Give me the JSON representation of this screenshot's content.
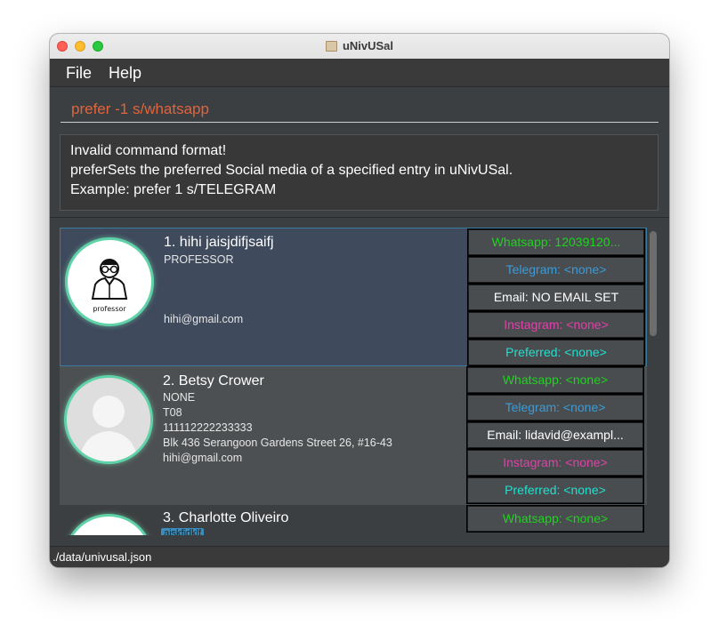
{
  "window": {
    "title": "uNivUSal"
  },
  "menu": {
    "file": "File",
    "help": "Help"
  },
  "command": {
    "value": "prefer -1 s/whatsapp"
  },
  "result": {
    "line1": "Invalid command format!",
    "line2": "preferSets the preferred Social media of a specified entry in uNivUSal.",
    "line3": "Example: prefer 1 s/TELEGRAM"
  },
  "contacts": [
    {
      "index_name": "1.  hihi jaisjdifjsaifj",
      "occupation": "PROFESSOR",
      "email": "hihi@gmail.com",
      "avatar_label": "professor",
      "social": {
        "whatsapp": "Whatsapp: 12039120...",
        "telegram": "Telegram: <none>",
        "email": "Email: NO EMAIL SET",
        "instagram": "Instagram: <none>",
        "preferred": "Preferred: <none>"
      }
    },
    {
      "index_name": "2.  Betsy Crower",
      "occupation": "NONE",
      "tutorial": "T08",
      "phone": "111112222233333",
      "address": "Blk 436 Serangoon Gardens Street 26, #16-43",
      "email": "hihi@gmail.com",
      "social": {
        "whatsapp": "Whatsapp: <none>",
        "telegram": "Telegram: <none>",
        "email": "Email: lidavid@exampl...",
        "instagram": "Instagram: <none>",
        "preferred": "Preferred: <none>"
      }
    },
    {
      "index_name": "3.  Charlotte Oliveiro",
      "tag": "aiskfidklf",
      "social": {
        "whatsapp": "Whatsapp: <none>"
      }
    }
  ],
  "status": {
    "path": "./data/univusal.json"
  },
  "colors": {
    "command_text": "#e0643c",
    "whatsapp": "#1ed31e",
    "telegram": "#3a9bd8",
    "instagram": "#e040a8",
    "preferred": "#20e0d0",
    "selected_card": "#3f4a5c"
  }
}
